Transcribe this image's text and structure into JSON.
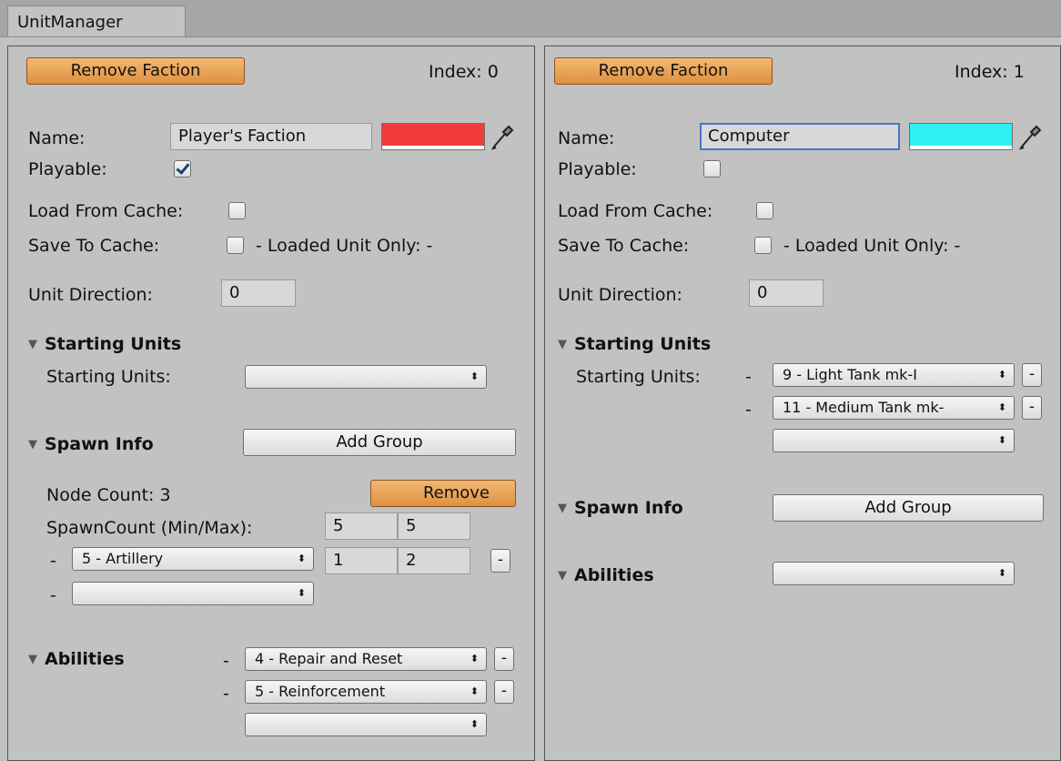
{
  "window": {
    "tab_title": "UnitManager"
  },
  "left": {
    "remove_faction": "Remove Faction",
    "index_label": "Index: 0",
    "name_label": "Name:",
    "name_value": "Player's Faction",
    "color": "#f23c3c",
    "playable_label": "Playable:",
    "playable": true,
    "load_cache_label": "Load From Cache:",
    "save_cache_label": "Save To Cache:",
    "loaded_only_label": "- Loaded Unit Only: -",
    "unit_direction_label": "Unit Direction:",
    "unit_direction_value": "0",
    "starting_units_header": "Starting Units",
    "starting_units_label": "Starting Units:",
    "spawn_info_header": "Spawn Info",
    "add_group": "Add Group",
    "node_count": "Node Count: 3",
    "remove": "Remove",
    "spawn_count_label": "SpawnCount (Min/Max):",
    "spawn_min": "5",
    "spawn_max": "5",
    "spawn_row_unit": "5 - Artillery",
    "spawn_row_min": "1",
    "spawn_row_max": "2",
    "abilities_header": "Abilities",
    "abilities": [
      "4 - Repair and Reset",
      "5 - Reinforcement"
    ]
  },
  "right": {
    "remove_faction": "Remove Faction",
    "index_label": "Index: 1",
    "name_label": "Name:",
    "name_value": "Computer",
    "color": "#2ef0f0",
    "playable_label": "Playable:",
    "playable": false,
    "load_cache_label": "Load From Cache:",
    "save_cache_label": "Save To Cache:",
    "loaded_only_label": "- Loaded Unit Only: -",
    "unit_direction_label": "Unit Direction:",
    "unit_direction_value": "0",
    "starting_units_header": "Starting Units",
    "starting_units_label": "Starting Units:",
    "starting_units": [
      "9 - Light Tank mk-I",
      "11 - Medium Tank mk-"
    ],
    "spawn_info_header": "Spawn Info",
    "add_group": "Add Group",
    "abilities_header": "Abilities"
  },
  "common": {
    "dash": "-",
    "arrows": "⬍",
    "fold_tri": "▼"
  }
}
